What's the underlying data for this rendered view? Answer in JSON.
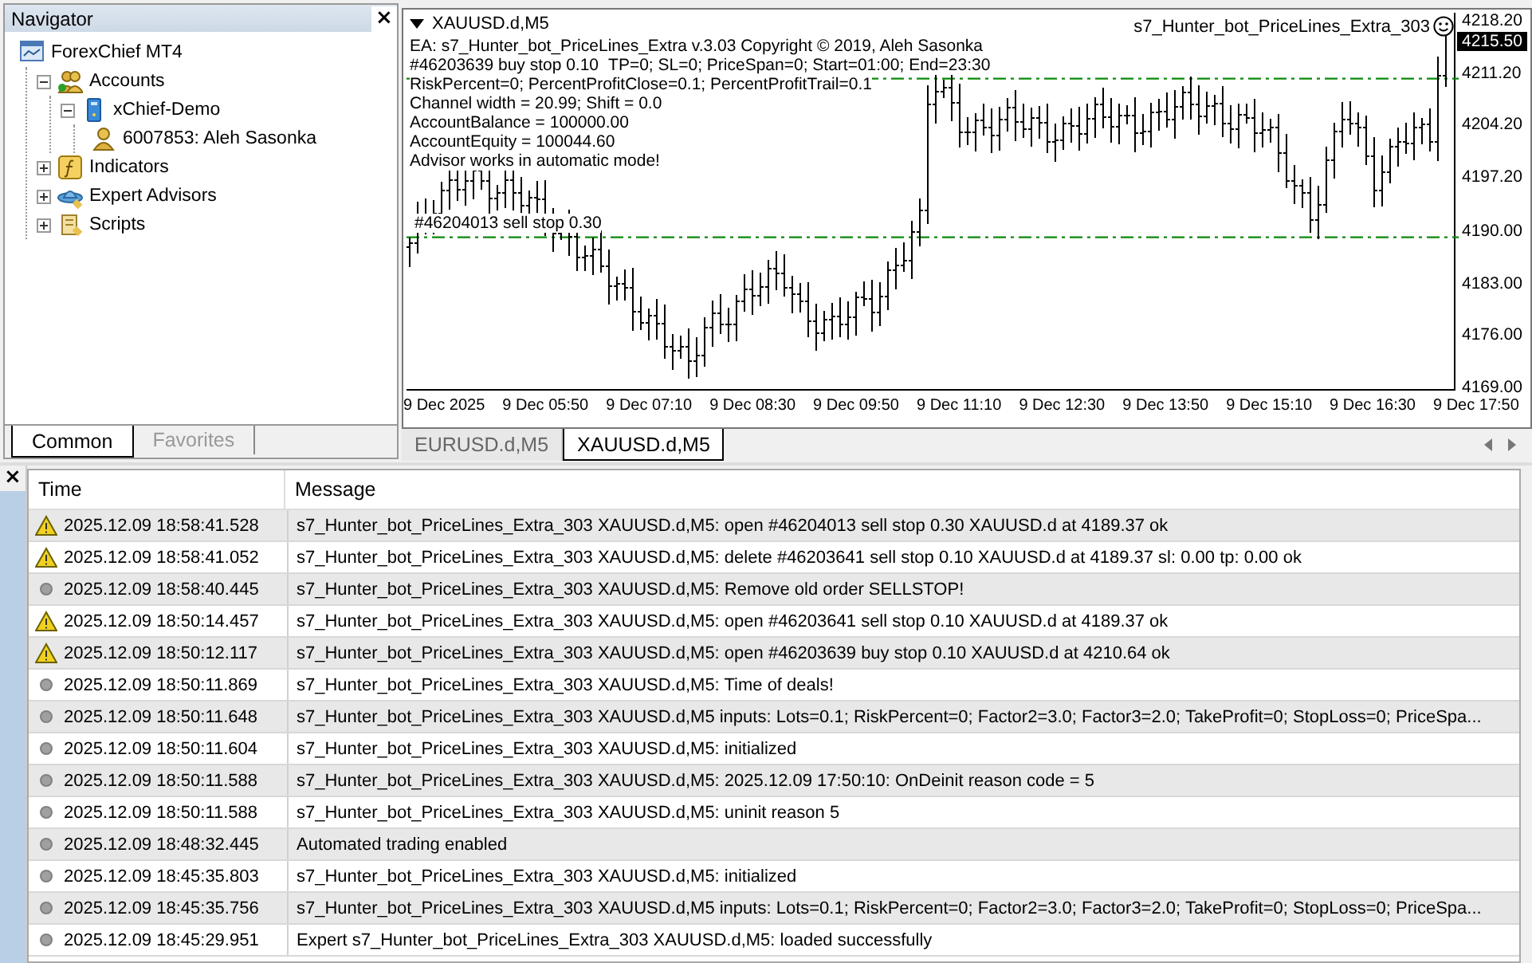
{
  "navigator": {
    "title": "Navigator",
    "close": "×",
    "tree": [
      {
        "kind": "terminal",
        "label": "ForexChief MT4",
        "children": [
          {
            "kind": "accounts",
            "label": "Accounts",
            "expanded": true,
            "children": [
              {
                "kind": "server",
                "label": "xChief-Demo",
                "expanded": true,
                "children": [
                  {
                    "kind": "account",
                    "label": "6007853: Aleh Sasonka"
                  }
                ]
              }
            ]
          },
          {
            "kind": "indicators",
            "label": "Indicators",
            "expanded": false
          },
          {
            "kind": "experts",
            "label": "Expert Advisors",
            "expanded": false
          },
          {
            "kind": "scripts",
            "label": "Scripts",
            "expanded": false
          }
        ]
      }
    ],
    "tabs": [
      {
        "label": "Common",
        "selected": true
      },
      {
        "label": "Favorites",
        "selected": false
      }
    ]
  },
  "chart": {
    "title": "XAUUSD.d,M5",
    "expert": "s7_Hunter_bot_PriceLines_Extra_303",
    "comment": [
      "EA: s7_Hunter_bot_PriceLines_Extra v.3.03 Copyright © 2019, Aleh Sasonka",
      "TP=0; SL=0; PriceSpan=0; Start=01:00; End=23:30",
      "RiskPercent=0; PercentProfitClose=0.1; PercentProfitTrail=0.1",
      "Channel width = 20.99; Shift = 0.0",
      "AccountBalance = 100000.00",
      "AccountEquity = 100044.60",
      "Advisor works in automatic mode!"
    ],
    "orders": [
      {
        "kind": "buy_stop",
        "label": "#46203639 buy stop 0.10"
      },
      {
        "kind": "sell_stop",
        "label": "#46204013 sell stop 0.30"
      }
    ],
    "y_ticks": [
      "4218.20",
      "4211.20",
      "4204.20",
      "4197.20",
      "4190.00",
      "4183.00",
      "4176.00",
      "4169.00"
    ],
    "current_price": "4215.50",
    "x_ticks": [
      "9 Dec 2025",
      "9 Dec 05:50",
      "9 Dec 07:10",
      "9 Dec 08:30",
      "9 Dec 09:50",
      "9 Dec 11:10",
      "9 Dec 12:30",
      "9 Dec 13:50",
      "9 Dec 15:10",
      "9 Dec 16:30",
      "9 Dec 17:50"
    ]
  },
  "chart_tabs": [
    {
      "label": "EURUSD.d,M5",
      "selected": false
    },
    {
      "label": "XAUUSD.d,M5",
      "selected": true
    }
  ],
  "terminal": {
    "close": "×",
    "columns": [
      "Time",
      "Message"
    ],
    "rows": [
      {
        "kind": "warning",
        "time": "2025.12.09 18:58:41.528",
        "message": "s7_Hunter_bot_PriceLines_Extra_303 XAUUSD.d,M5: open #46204013 sell stop 0.30 XAUUSD.d at 4189.37 ok"
      },
      {
        "kind": "warning",
        "time": "2025.12.09 18:58:41.052",
        "message": "s7_Hunter_bot_PriceLines_Extra_303 XAUUSD.d,M5: delete #46203641 sell stop 0.10 XAUUSD.d at 4189.37 sl: 0.00 tp: 0.00 ok"
      },
      {
        "kind": "info",
        "time": "2025.12.09 18:58:40.445",
        "message": "s7_Hunter_bot_PriceLines_Extra_303 XAUUSD.d,M5: Remove old order SELLSTOP!"
      },
      {
        "kind": "warning",
        "time": "2025.12.09 18:50:14.457",
        "message": "s7_Hunter_bot_PriceLines_Extra_303 XAUUSD.d,M5: open #46203641 sell stop 0.10 XAUUSD.d at 4189.37 ok"
      },
      {
        "kind": "warning",
        "time": "2025.12.09 18:50:12.117",
        "message": "s7_Hunter_bot_PriceLines_Extra_303 XAUUSD.d,M5: open #46203639 buy stop 0.10 XAUUSD.d at 4210.64 ok"
      },
      {
        "kind": "info",
        "time": "2025.12.09 18:50:11.869",
        "message": "s7_Hunter_bot_PriceLines_Extra_303 XAUUSD.d,M5: Time of deals!"
      },
      {
        "kind": "info",
        "time": "2025.12.09 18:50:11.648",
        "message": "s7_Hunter_bot_PriceLines_Extra_303 XAUUSD.d,M5 inputs: Lots=0.1; RiskPercent=0; Factor2=3.0; Factor3=2.0; TakeProfit=0; StopLoss=0; PriceSpa..."
      },
      {
        "kind": "info",
        "time": "2025.12.09 18:50:11.604",
        "message": "s7_Hunter_bot_PriceLines_Extra_303 XAUUSD.d,M5: initialized"
      },
      {
        "kind": "info",
        "time": "2025.12.09 18:50:11.588",
        "message": "s7_Hunter_bot_PriceLines_Extra_303 XAUUSD.d,M5: 2025.12.09 17:50:10: OnDeinit reason code = 5"
      },
      {
        "kind": "info",
        "time": "2025.12.09 18:50:11.588",
        "message": "s7_Hunter_bot_PriceLines_Extra_303 XAUUSD.d,M5: uninit reason 5"
      },
      {
        "kind": "info",
        "time": "2025.12.09 18:48:32.445",
        "message": "Automated trading enabled"
      },
      {
        "kind": "info",
        "time": "2025.12.09 18:45:35.803",
        "message": "s7_Hunter_bot_PriceLines_Extra_303 XAUUSD.d,M5: initialized"
      },
      {
        "kind": "info",
        "time": "2025.12.09 18:45:35.756",
        "message": "s7_Hunter_bot_PriceLines_Extra_303 XAUUSD.d,M5 inputs: Lots=0.1; RiskPercent=0; Factor2=3.0; Factor3=2.0; TakeProfit=0; StopLoss=0; PriceSpa..."
      },
      {
        "kind": "info",
        "time": "2025.12.09 18:45:29.951",
        "message": "Expert s7_Hunter_bot_PriceLines_Extra_303 XAUUSD.d,M5: loaded successfully"
      }
    ]
  }
}
